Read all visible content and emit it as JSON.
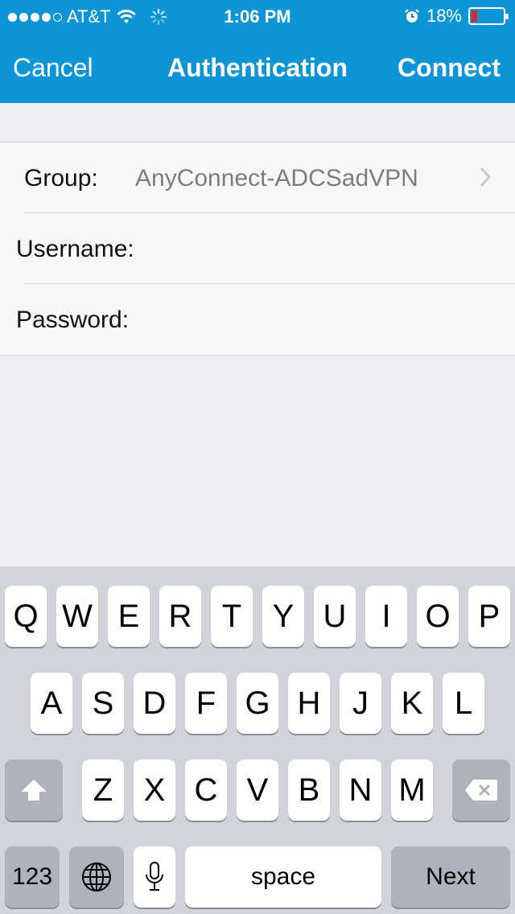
{
  "status_bar": {
    "carrier": "AT&T",
    "time": "1:06 PM",
    "battery_percent": "18%",
    "battery_level": 0.18,
    "signal_bars_filled": 4,
    "signal_bars_total": 5,
    "icons": [
      "wifi-icon",
      "activity-spinner-icon",
      "alarm-clock-icon",
      "battery-icon"
    ]
  },
  "nav": {
    "cancel_label": "Cancel",
    "title": "Authentication",
    "connect_label": "Connect",
    "background_color": "#0b95d6"
  },
  "form": {
    "group_label": "Group:",
    "group_value": "AnyConnect-ADCSadVPN",
    "username_label": "Username:",
    "username_value": "",
    "password_label": "Password:",
    "password_value": ""
  },
  "keyboard": {
    "row1": [
      "Q",
      "W",
      "E",
      "R",
      "T",
      "Y",
      "U",
      "I",
      "O",
      "P"
    ],
    "row2": [
      "A",
      "S",
      "D",
      "F",
      "G",
      "H",
      "J",
      "K",
      "L"
    ],
    "row3": [
      "Z",
      "X",
      "C",
      "V",
      "B",
      "N",
      "M"
    ],
    "numbers_label": "123",
    "space_label": "space",
    "next_label": "Next"
  }
}
